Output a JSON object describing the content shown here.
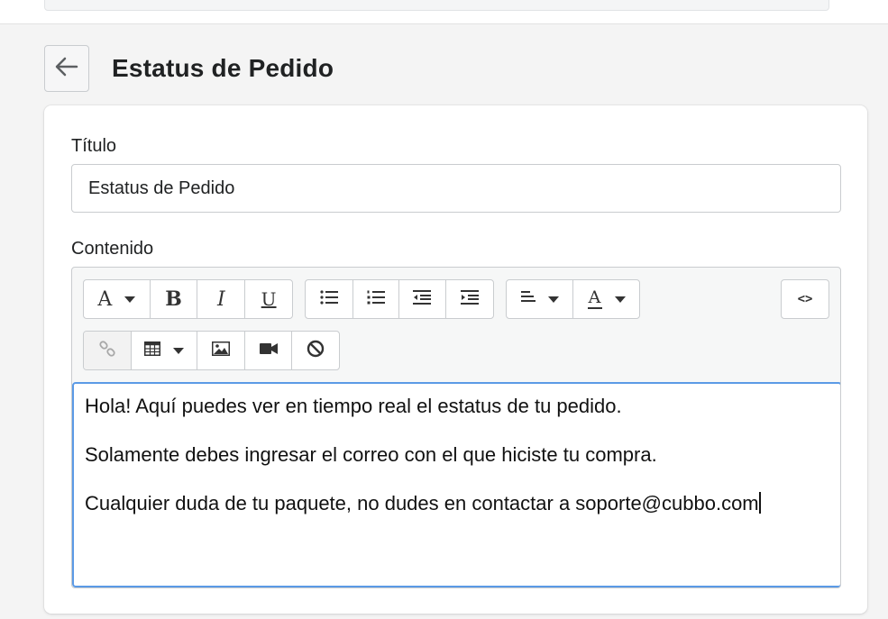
{
  "page": {
    "title": "Estatus de Pedido",
    "back_icon": "arrow-left-icon"
  },
  "form": {
    "title_label": "Título",
    "title_value": "Estatus de Pedido",
    "content_label": "Contenido"
  },
  "toolbar": {
    "font_style_glyph": "A",
    "bold_glyph": "B",
    "italic_glyph": "I",
    "underline_glyph": "U",
    "font_color_glyph": "A",
    "code_view_glyph": "<>",
    "icons": [
      "font-style-icon",
      "bold-icon",
      "italic-icon",
      "underline-icon",
      "unordered-list-icon",
      "ordered-list-icon",
      "outdent-icon",
      "indent-icon",
      "align-left-icon",
      "font-color-icon",
      "code-view-icon",
      "link-icon",
      "table-icon",
      "image-icon",
      "video-icon",
      "clear-format-icon"
    ]
  },
  "editor": {
    "paragraphs": [
      "Hola! Aquí puedes ver en tiempo real el estatus de tu pedido.",
      "Solamente debes ingresar el correo con el que hiciste tu compra.",
      "Cualquier duda de tu paquete, no dudes en contactar a soporte@cubbo.com"
    ]
  },
  "colors": {
    "focus_border": "#5b9ae6",
    "background": "#f4f4f4",
    "card": "#ffffff"
  }
}
